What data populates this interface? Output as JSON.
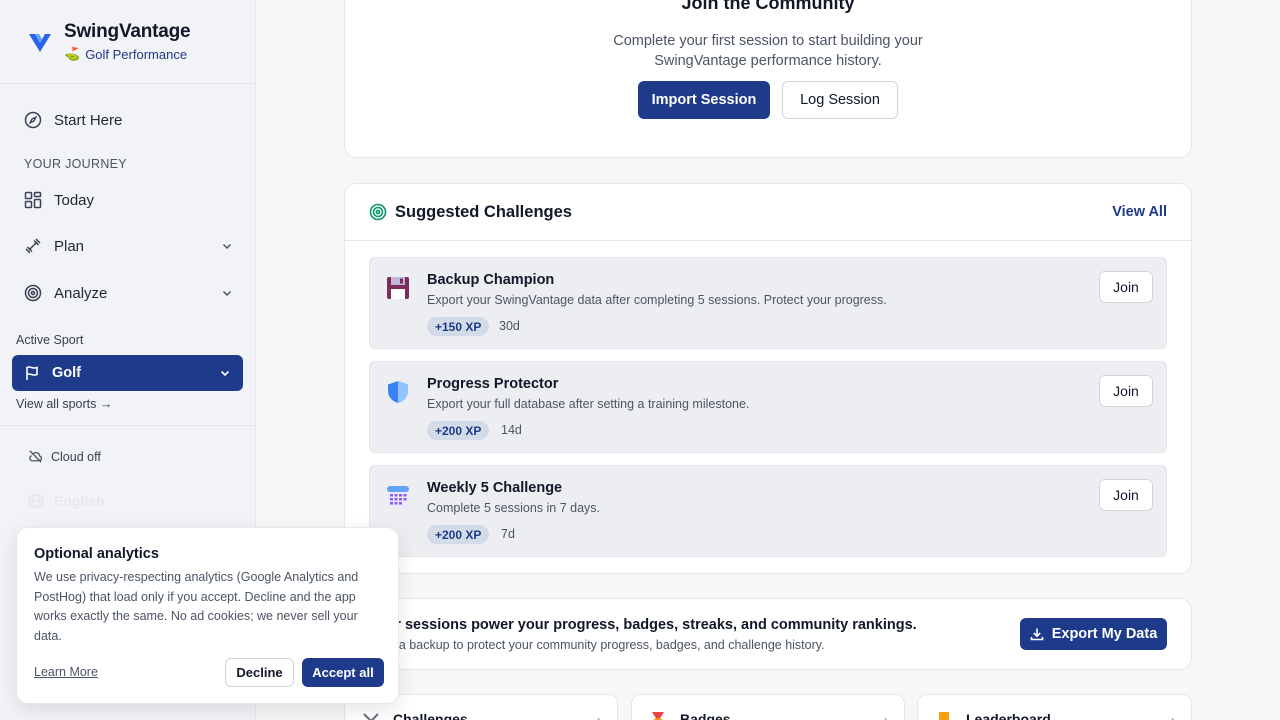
{
  "brand": {
    "name": "SwingVantage",
    "subtitle": "Golf Performance",
    "subtitle_icon": "golf-flag-emoji"
  },
  "sidebar": {
    "start_here": "Start Here",
    "section_label": "YOUR JOURNEY",
    "items": [
      {
        "label": "Today",
        "icon": "grid-icon"
      },
      {
        "label": "Plan",
        "icon": "dumbbell-icon"
      },
      {
        "label": "Analyze",
        "icon": "target-icon"
      }
    ],
    "active_sport_label": "Active Sport",
    "active_sport": "Golf",
    "view_all_sports": "View all sports →",
    "cloud_status": "Cloud off",
    "language": "English"
  },
  "community": {
    "title": "Join the Community",
    "description_line1": "Complete your first session to start building your",
    "description_line2": "SwingVantage performance history.",
    "import_button": "Import Session",
    "log_button": "Log Session"
  },
  "challenges": {
    "title": "Suggested Challenges",
    "view_all": "View All",
    "join_label": "Join",
    "items": [
      {
        "name": "Backup Champion",
        "description": "Export your SwingVantage data after completing 5 sessions. Protect your progress.",
        "xp": "+150 XP",
        "days": "30d",
        "icon": "floppy-disk-icon"
      },
      {
        "name": "Progress Protector",
        "description": "Export your full database after setting a training milestone.",
        "xp": "+200 XP",
        "days": "14d",
        "icon": "shield-icon"
      },
      {
        "name": "Weekly 5 Challenge",
        "description": "Complete 5 sessions in 7 days.",
        "xp": "+200 XP",
        "days": "7d",
        "icon": "calendar-icon"
      }
    ]
  },
  "export": {
    "title": "Your sessions power your progress, badges, streaks, and community rankings.",
    "subtitle": "Start a backup to protect your community progress, badges, and challenge history.",
    "button": "Export My Data"
  },
  "shortcuts": [
    {
      "label": "Challenges",
      "icon": "swords-icon"
    },
    {
      "label": "Badges",
      "icon": "medal-icon"
    },
    {
      "label": "Leaderboard",
      "icon": "trophy-icon"
    }
  ],
  "consent": {
    "title": "Optional analytics",
    "text": "We use privacy-respecting analytics (Google Analytics and PostHog) that load only if you accept. Decline and the app works exactly the same. No ad cookies; we never sell your data.",
    "learn_more": "Learn More",
    "decline": "Decline",
    "accept": "Accept all"
  },
  "colors": {
    "accent": "#1e3a8a",
    "sidebar_bg": "#f1f3f6",
    "page_bg": "#f6f7f9"
  }
}
